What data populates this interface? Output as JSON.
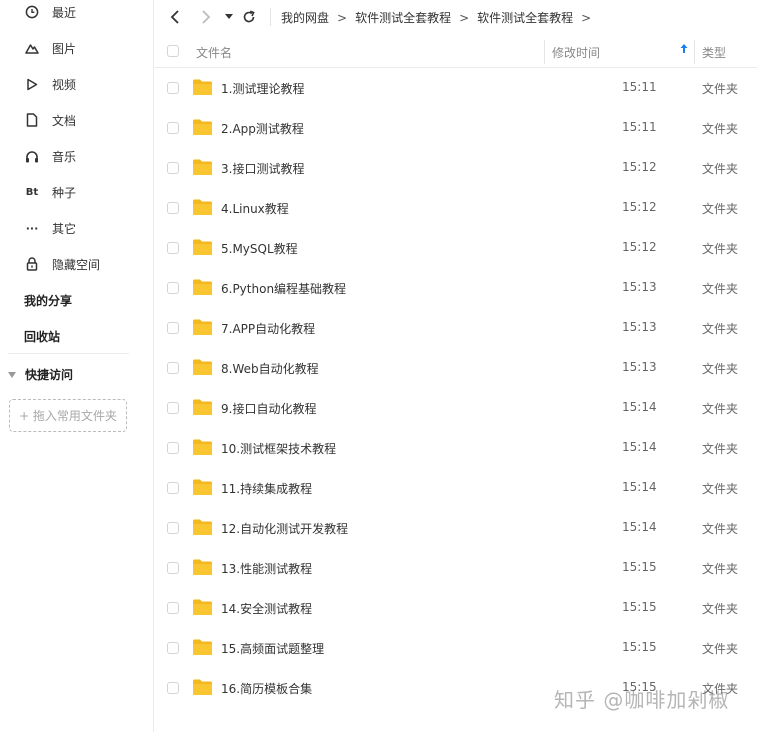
{
  "sidebar": {
    "items": [
      {
        "label": "最近",
        "icon": "clock-icon"
      },
      {
        "label": "图片",
        "icon": "mountain-icon"
      },
      {
        "label": "视频",
        "icon": "play-icon"
      },
      {
        "label": "文档",
        "icon": "document-icon"
      },
      {
        "label": "音乐",
        "icon": "headphones-icon"
      },
      {
        "label": "种子",
        "icon": "bt-icon",
        "glyph": "Bt"
      },
      {
        "label": "其它",
        "icon": "more-icon",
        "glyph": "···"
      },
      {
        "label": "隐藏空间",
        "icon": "lock-icon"
      }
    ],
    "my_share": "我的分享",
    "recycle_bin": "回收站",
    "quick_access": "快捷访问",
    "add_folder": "+ 拖入常用文件夹"
  },
  "breadcrumb": [
    "我的网盘",
    "软件测试全套教程",
    "软件测试全套教程"
  ],
  "table": {
    "columns": {
      "name": "文件名",
      "modified": "修改时间",
      "type": "类型"
    },
    "rows": [
      {
        "name": "1.测试理论教程",
        "time": "15:11",
        "type": "文件夹"
      },
      {
        "name": "2.App测试教程",
        "time": "15:11",
        "type": "文件夹"
      },
      {
        "name": "3.接口测试教程",
        "time": "15:12",
        "type": "文件夹"
      },
      {
        "name": "4.Linux教程",
        "time": "15:12",
        "type": "文件夹"
      },
      {
        "name": "5.MySQL教程",
        "time": "15:12",
        "type": "文件夹"
      },
      {
        "name": "6.Python编程基础教程",
        "time": "15:13",
        "type": "文件夹"
      },
      {
        "name": "7.APP自动化教程",
        "time": "15:13",
        "type": "文件夹"
      },
      {
        "name": "8.Web自动化教程",
        "time": "15:13",
        "type": "文件夹"
      },
      {
        "name": "9.接口自动化教程",
        "time": "15:14",
        "type": "文件夹"
      },
      {
        "name": "10.测试框架技术教程",
        "time": "15:14",
        "type": "文件夹"
      },
      {
        "name": "11.持续集成教程",
        "time": "15:14",
        "type": "文件夹"
      },
      {
        "name": "12.自动化测试开发教程",
        "time": "15:14",
        "type": "文件夹"
      },
      {
        "name": "13.性能测试教程",
        "time": "15:15",
        "type": "文件夹"
      },
      {
        "name": "14.安全测试教程",
        "time": "15:15",
        "type": "文件夹"
      },
      {
        "name": "15.高频面试题整理",
        "time": "15:15",
        "type": "文件夹"
      },
      {
        "name": "16.简历模板合集",
        "time": "15:15",
        "type": "文件夹"
      }
    ]
  },
  "watermark": "知乎 @咖啡加剁椒",
  "colors": {
    "folder": "#f9c531",
    "folder_tab": "#f2b81d",
    "sort_arrow": "#1a7df2"
  }
}
